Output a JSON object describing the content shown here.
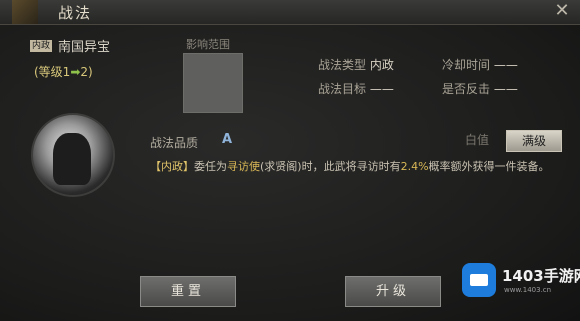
{
  "window": {
    "title": "战法",
    "close_symbol": "✕"
  },
  "skill": {
    "tag": "内政",
    "name": "南国异宝",
    "level_prefix": "(等级1",
    "level_arrow": "➡",
    "level_suffix": "2)"
  },
  "effect_range": {
    "label": "影响范围"
  },
  "info": {
    "type_label": "战法类型",
    "type_value": "内政",
    "cooldown_label": "冷却时间",
    "cooldown_value": "——",
    "target_label": "战法目标",
    "target_value": "——",
    "counter_label": "是否反击",
    "counter_value": "——"
  },
  "quality": {
    "label": "战法品质",
    "value": "A"
  },
  "toggle": {
    "base_label": "白值",
    "max_label": "满级"
  },
  "description": {
    "part1": "【内政】",
    "part2": "委任为",
    "part3": "寻访使",
    "part4": "(求贤阁)时，此武将寻访时有",
    "part5": "2.4%",
    "part6": "概率额外获得一件装备。"
  },
  "buttons": {
    "reset": "重置",
    "upgrade": "升级"
  },
  "watermark": {
    "brand": "1403手游网",
    "sub": "www.1403.cn"
  }
}
